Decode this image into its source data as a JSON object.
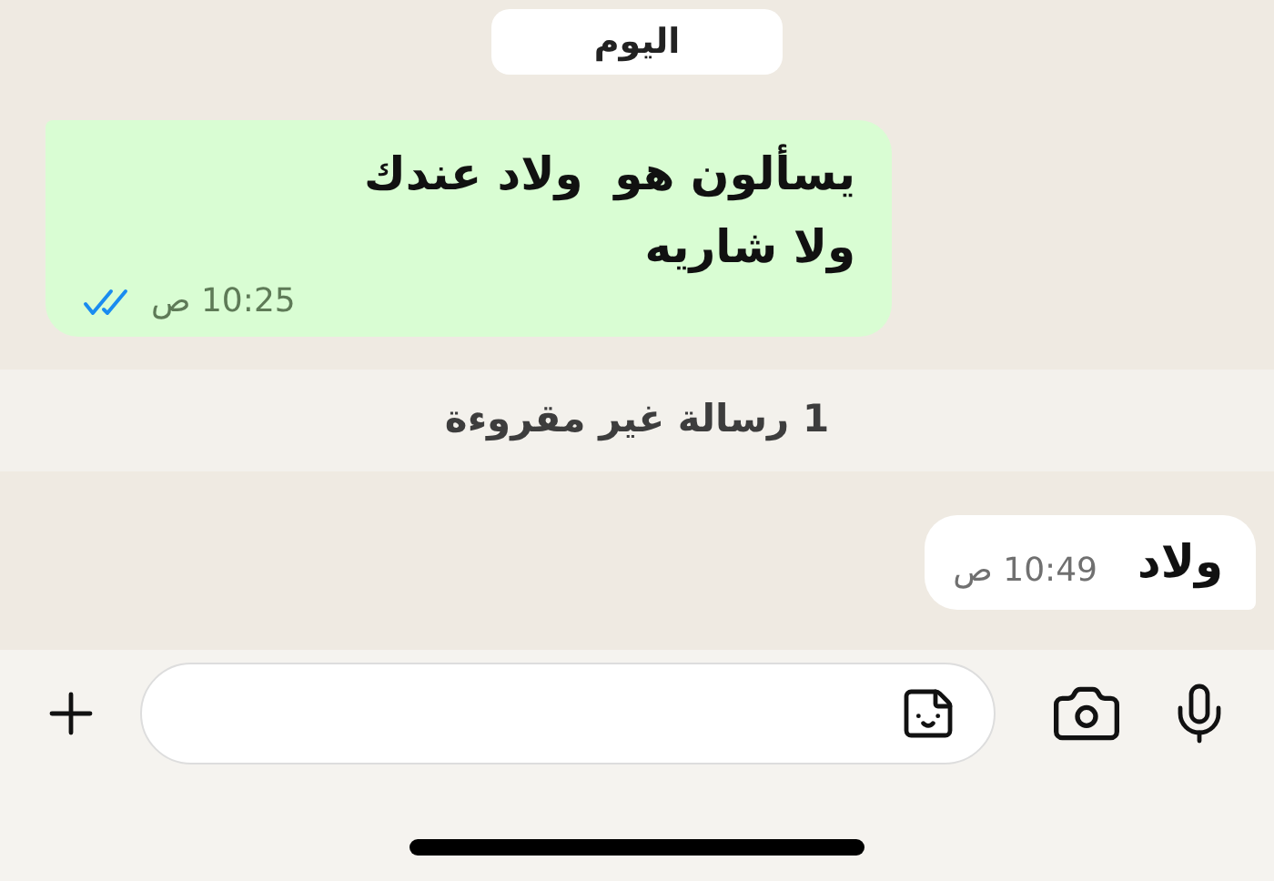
{
  "date_label": "اليوم",
  "messages": [
    {
      "kind": "outgoing",
      "text": "يسألون هو  ولاد عندك\nولا شاريه",
      "time": "10:25 ص",
      "read": true
    },
    {
      "kind": "unread_banner",
      "text": "1 رسالة غير مقروءة"
    },
    {
      "kind": "incoming",
      "text": "ولاد",
      "time": "10:49 ص"
    }
  ]
}
